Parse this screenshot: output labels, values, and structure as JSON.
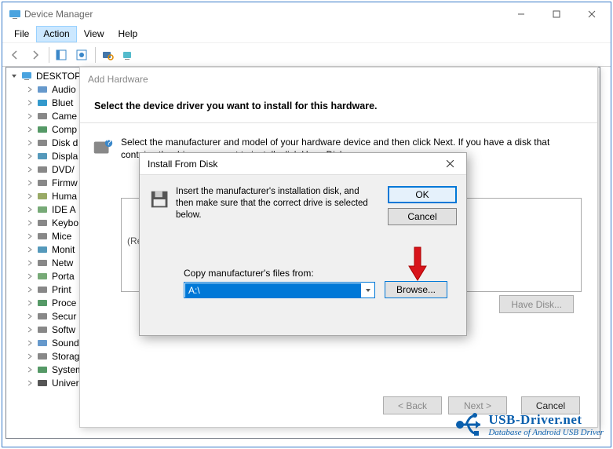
{
  "window": {
    "title": "Device Manager",
    "menu": {
      "file": "File",
      "action": "Action",
      "view": "View",
      "help": "Help"
    },
    "toolbar_icons": [
      "back",
      "forward",
      "list",
      "help",
      "scan",
      "monitor"
    ]
  },
  "tree": {
    "root": "DESKTOP",
    "items": [
      {
        "label": "Audio"
      },
      {
        "label": "Bluet"
      },
      {
        "label": "Came"
      },
      {
        "label": "Comp"
      },
      {
        "label": "Disk d"
      },
      {
        "label": "Displa"
      },
      {
        "label": "DVD/"
      },
      {
        "label": "Firmw"
      },
      {
        "label": "Huma"
      },
      {
        "label": "IDE A"
      },
      {
        "label": "Keybo"
      },
      {
        "label": "Mice"
      },
      {
        "label": "Monit"
      },
      {
        "label": "Netw"
      },
      {
        "label": "Porta"
      },
      {
        "label": "Print"
      },
      {
        "label": "Proce"
      },
      {
        "label": "Secur"
      },
      {
        "label": "Softw"
      },
      {
        "label": "Sound"
      },
      {
        "label": "Storag"
      },
      {
        "label": "System"
      },
      {
        "label": "Universal Serial Bus controllers"
      }
    ]
  },
  "addhw": {
    "title": "Add Hardware",
    "heading": "Select the device driver you want to install for this hardware.",
    "instruction": "Select the manufacturer and model of your hardware device and then click Next. If you have a disk that contains the driver you want to install, click Have Disk.",
    "retrieving": "(Retrieving a list of all devices)",
    "have_disk": "Have Disk...",
    "back": "< Back",
    "next": "Next >",
    "cancel": "Cancel"
  },
  "ifd": {
    "title": "Install From Disk",
    "text": "Insert the manufacturer's installation disk, and then make sure that the correct drive is selected below.",
    "ok": "OK",
    "cancel": "Cancel",
    "label": "Copy manufacturer's files from:",
    "value": "A:\\",
    "browse": "Browse..."
  },
  "watermark": {
    "line1": "USB-Driver.net",
    "line2": "Database of Android USB Driver"
  }
}
